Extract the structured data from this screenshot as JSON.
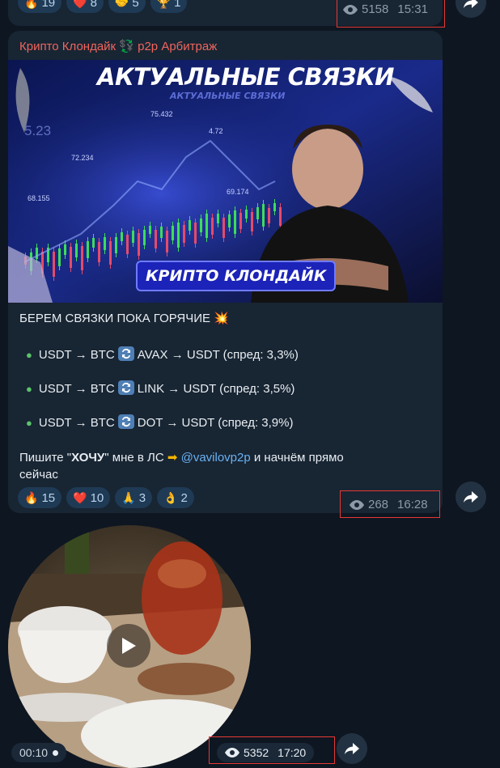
{
  "top_message": {
    "reactions": [
      {
        "emoji": "🔥",
        "count": "19"
      },
      {
        "emoji": "❤️",
        "count": "8"
      },
      {
        "emoji": "🤝",
        "count": "5"
      },
      {
        "emoji": "🏆",
        "count": "1"
      }
    ],
    "views": "5158",
    "time": "15:31"
  },
  "post": {
    "channel_name": "Крипто Клондайк 💱 p2p Арбитраж",
    "banner": {
      "headline": "АКТУАЛЬНЫЕ СВЯЗКИ",
      "subheadline": "АКТУАЛЬНЫЕ СВЯЗКИ",
      "badge": "КРИПТО КЛОНДАЙК",
      "chart_labels": [
        "75.432",
        "4.72",
        "72.234",
        "68.155",
        "5.23",
        "69.174"
      ]
    },
    "intro": "БЕРЕМ СВЯЗКИ ПОКА ГОРЯЧИЕ",
    "intro_emoji": "💥",
    "items": [
      {
        "pre": "USDT → BTC",
        "post": "AVAX → USDT (спред: 3,3%)"
      },
      {
        "pre": "USDT → BTC",
        "post": "LINK → USDT (спред: 3,5%)"
      },
      {
        "pre": "USDT → BTC",
        "post": "DOT → USDT (спред: 3,9%)"
      }
    ],
    "cta_pre": "Пишите \"",
    "cta_bold": "ХОЧУ",
    "cta_mid": "\" мне в ЛС",
    "cta_arrow": "➡",
    "cta_link": "@vavilovp2p",
    "cta_post": "и начнём прямо",
    "cta_line2": "сейчас",
    "reactions": [
      {
        "emoji": "🔥",
        "count": "15"
      },
      {
        "emoji": "❤️",
        "count": "10"
      },
      {
        "emoji": "🙏",
        "count": "3"
      },
      {
        "emoji": "👌",
        "count": "2"
      }
    ],
    "views": "268",
    "time": "16:28"
  },
  "video_message": {
    "duration": "00:10",
    "views": "5352",
    "time": "17:20"
  },
  "colors": {
    "background": "#0e1621",
    "bubble": "#182533",
    "channel_name": "#f0655c",
    "link": "#6ab2f2",
    "highlight_box": "#e53935"
  }
}
